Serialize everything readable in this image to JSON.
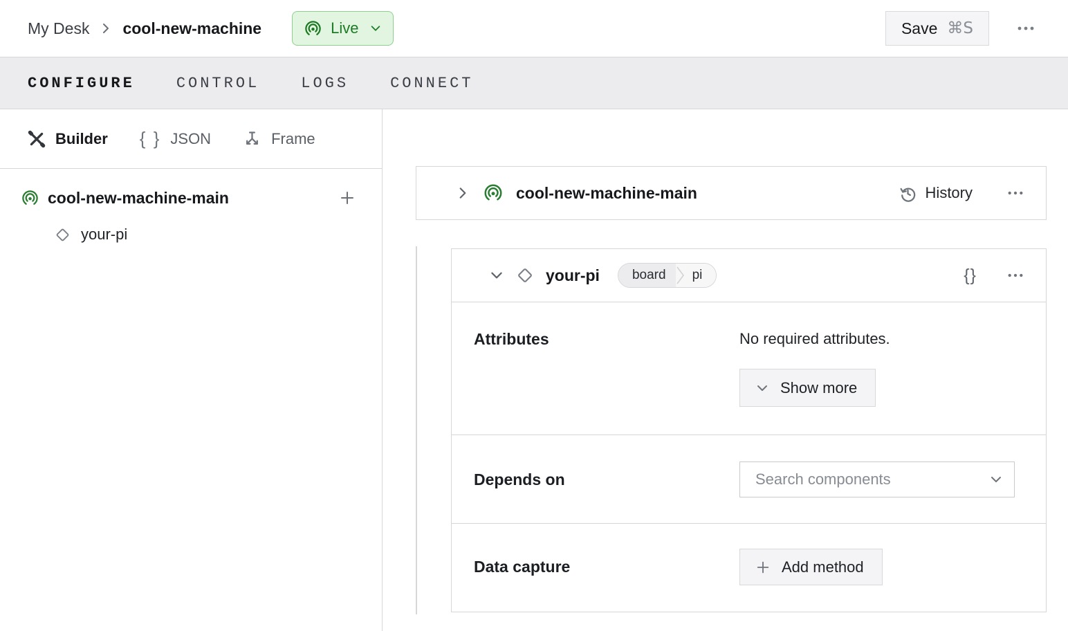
{
  "header": {
    "breadcrumb": {
      "section": "My Desk",
      "machine": "cool-new-machine"
    },
    "live_badge": {
      "label": "Live",
      "icon": "broadcast-icon"
    },
    "save_button": {
      "label": "Save",
      "shortcut": "⌘S"
    },
    "overflow_icon": "ellipsis-icon"
  },
  "tabs": [
    {
      "label": "CONFIGURE",
      "active": true
    },
    {
      "label": "CONTROL",
      "active": false
    },
    {
      "label": "LOGS",
      "active": false
    },
    {
      "label": "CONNECT",
      "active": false
    }
  ],
  "sidebar": {
    "view_modes": [
      {
        "label": "Builder",
        "icon": "crossed-tools-icon",
        "active": true
      },
      {
        "label": "JSON",
        "icon": "braces-icon",
        "active": false
      },
      {
        "label": "Frame",
        "icon": "frame-axes-icon",
        "active": false
      }
    ],
    "tree": {
      "root_label": "cool-new-machine-main",
      "root_icon": "broadcast-icon",
      "add_button": "+",
      "child_label": "your-pi",
      "child_icon": "diamond-icon"
    }
  },
  "main": {
    "machine_card": {
      "title": "cool-new-machine-main",
      "history_label": "History",
      "icons": [
        "chevron-right-icon",
        "broadcast-icon",
        "history-icon",
        "ellipsis-icon"
      ]
    },
    "component_card": {
      "title": "your-pi",
      "type_badge": "board",
      "model_badge": "pi",
      "braces_glyph": "{}",
      "attributes": {
        "label": "Attributes",
        "empty_text": "No required attributes.",
        "show_more_label": "Show more"
      },
      "depends_on": {
        "label": "Depends on",
        "search_placeholder": "Search components"
      },
      "data_capture": {
        "label": "Data capture",
        "add_method_label": "Add method"
      }
    }
  },
  "icons": {
    "braces": "{ }"
  },
  "colors": {
    "live_bg": "#e1f5e1",
    "live_border": "#8ecf8e",
    "live_text": "#1e7a24",
    "brand_green": "#2b7d33",
    "tabbar_bg": "#ececee",
    "border": "#d6d7d9",
    "button_bg": "#f4f4f6",
    "text_primary": "#16181b",
    "text_secondary": "#3c4046",
    "placeholder": "#878c93"
  }
}
